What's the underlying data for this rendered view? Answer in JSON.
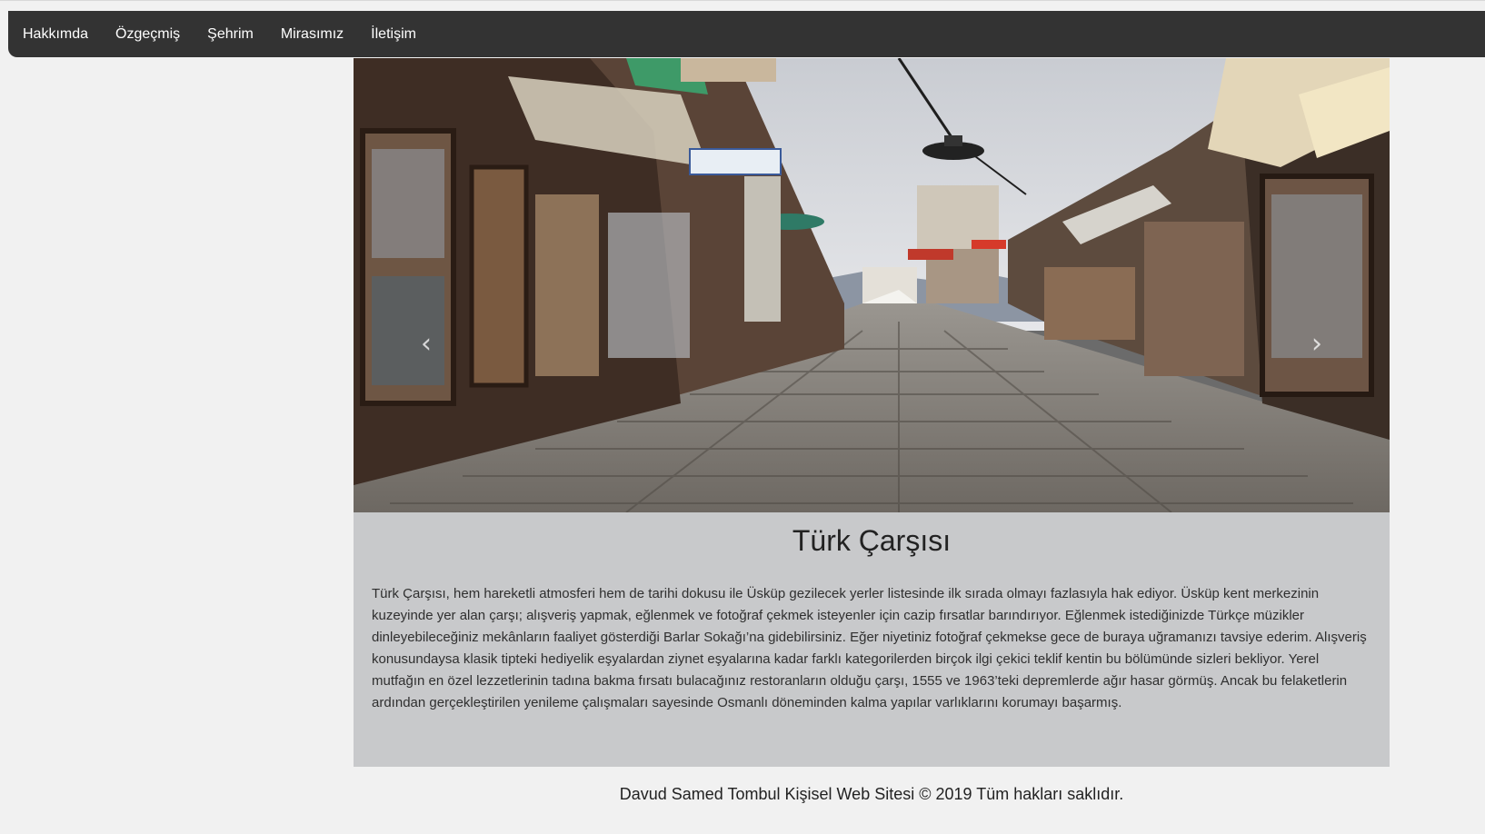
{
  "nav": {
    "items": [
      {
        "label": "Hakkımda"
      },
      {
        "label": "Özgeçmiş"
      },
      {
        "label": "Şehrim"
      },
      {
        "label": "Mirasımız"
      },
      {
        "label": "İletişim"
      }
    ]
  },
  "carousel": {
    "prev_icon": "chevron-left-icon",
    "next_icon": "chevron-right-icon",
    "prev_glyph": "‹",
    "next_glyph": "›"
  },
  "article": {
    "title": "Türk Çarşısı",
    "body": "Türk Çarşısı, hem hareketli atmosferi hem de tarihi dokusu ile Üsküp gezilecek yerler listesinde ilk sırada olmayı fazlasıyla hak ediyor. Üsküp kent merkezinin kuzeyinde yer alan çarşı; alışveriş yapmak, eğlenmek ve fotoğraf çekmek isteyenler için cazip fırsatlar barındırıyor. Eğlenmek istediğinizde Türkçe müzikler dinleyebileceğiniz mekânların faaliyet gösterdiği Barlar Sokağı’na gidebilirsiniz. Eğer niyetiniz fotoğraf çekmekse gece de buraya uğramanızı tavsiye ederim. Alışveriş konusundaysa klasik tipteki hediyelik eşyalardan ziynet eşyalarına kadar farklı kategorilerden birçok ilgi çekici teklif kentin bu bölümünde sizleri bekliyor. Yerel mutfağın en özel lezzetlerinin tadına bakma fırsatı bulacağınız restoranların olduğu çarşı, 1555 ve 1963’teki depremlerde ağır hasar görmüş. Ancak bu felaketlerin ardından gerçekleştirilen yenileme çalışmaları sayesinde Osmanlı döneminden kalma yapılar varlıklarını korumayı başarmış."
  },
  "footer": {
    "text": "Davud Samed Tombul Kişisel Web Sitesi © 2019 Tüm hakları saklıdır."
  },
  "colors": {
    "navbar": "#333333",
    "page_bg": "#f1f1f1",
    "content_bg": "#c8c9cb"
  }
}
